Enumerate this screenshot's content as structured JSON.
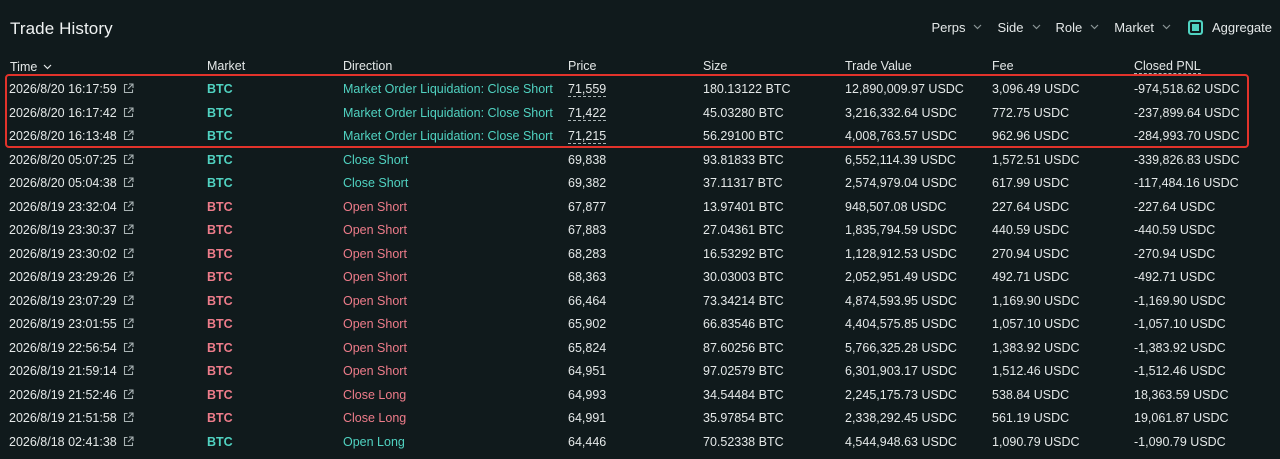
{
  "header": {
    "title": "Trade History",
    "filters": [
      "Perps",
      "Side",
      "Role",
      "Market"
    ],
    "aggregate_label": "Aggregate",
    "aggregate_checked": true
  },
  "columns": {
    "time": "Time",
    "market": "Market",
    "direction": "Direction",
    "price": "Price",
    "size": "Size",
    "trade_value": "Trade Value",
    "fee": "Fee",
    "closed_pnl": "Closed PNL"
  },
  "colors": {
    "accent_teal": "#50d2c1",
    "sell_red": "#ee7c8a",
    "highlight_red": "#e2332b",
    "background": "#101a1c"
  },
  "rows": [
    {
      "time": "2026/8/20 16:17:59",
      "market": "BTC",
      "market_side": "buy",
      "direction": "Market Order Liquidation: Close Short",
      "dir_side": "buy",
      "price": "71,559",
      "price_dotted": true,
      "size": "180.13122 BTC",
      "trade_value": "12,890,009.97 USDC",
      "fee": "3,096.49 USDC",
      "closed_pnl": "-974,518.62 USDC"
    },
    {
      "time": "2026/8/20 16:17:42",
      "market": "BTC",
      "market_side": "buy",
      "direction": "Market Order Liquidation: Close Short",
      "dir_side": "buy",
      "price": "71,422",
      "price_dotted": true,
      "size": "45.03280 BTC",
      "trade_value": "3,216,332.64 USDC",
      "fee": "772.75 USDC",
      "closed_pnl": "-237,899.64 USDC"
    },
    {
      "time": "2026/8/20 16:13:48",
      "market": "BTC",
      "market_side": "buy",
      "direction": "Market Order Liquidation: Close Short",
      "dir_side": "buy",
      "price": "71,215",
      "price_dotted": true,
      "size": "56.29100 BTC",
      "trade_value": "4,008,763.57 USDC",
      "fee": "962.96 USDC",
      "closed_pnl": "-284,993.70 USDC"
    },
    {
      "time": "2026/8/20 05:07:25",
      "market": "BTC",
      "market_side": "buy",
      "direction": "Close Short",
      "dir_side": "buy",
      "price": "69,838",
      "price_dotted": false,
      "size": "93.81833 BTC",
      "trade_value": "6,552,114.39 USDC",
      "fee": "1,572.51 USDC",
      "closed_pnl": "-339,826.83 USDC"
    },
    {
      "time": "2026/8/20 05:04:38",
      "market": "BTC",
      "market_side": "buy",
      "direction": "Close Short",
      "dir_side": "buy",
      "price": "69,382",
      "price_dotted": false,
      "size": "37.11317 BTC",
      "trade_value": "2,574,979.04 USDC",
      "fee": "617.99 USDC",
      "closed_pnl": "-117,484.16 USDC"
    },
    {
      "time": "2026/8/19 23:32:04",
      "market": "BTC",
      "market_side": "sell",
      "direction": "Open Short",
      "dir_side": "sell",
      "price": "67,877",
      "price_dotted": false,
      "size": "13.97401 BTC",
      "trade_value": "948,507.08 USDC",
      "fee": "227.64 USDC",
      "closed_pnl": "-227.64 USDC"
    },
    {
      "time": "2026/8/19 23:30:37",
      "market": "BTC",
      "market_side": "sell",
      "direction": "Open Short",
      "dir_side": "sell",
      "price": "67,883",
      "price_dotted": false,
      "size": "27.04361 BTC",
      "trade_value": "1,835,794.59 USDC",
      "fee": "440.59 USDC",
      "closed_pnl": "-440.59 USDC"
    },
    {
      "time": "2026/8/19 23:30:02",
      "market": "BTC",
      "market_side": "sell",
      "direction": "Open Short",
      "dir_side": "sell",
      "price": "68,283",
      "price_dotted": false,
      "size": "16.53292 BTC",
      "trade_value": "1,128,912.53 USDC",
      "fee": "270.94 USDC",
      "closed_pnl": "-270.94 USDC"
    },
    {
      "time": "2026/8/19 23:29:26",
      "market": "BTC",
      "market_side": "sell",
      "direction": "Open Short",
      "dir_side": "sell",
      "price": "68,363",
      "price_dotted": false,
      "size": "30.03003 BTC",
      "trade_value": "2,052,951.49 USDC",
      "fee": "492.71 USDC",
      "closed_pnl": "-492.71 USDC"
    },
    {
      "time": "2026/8/19 23:07:29",
      "market": "BTC",
      "market_side": "sell",
      "direction": "Open Short",
      "dir_side": "sell",
      "price": "66,464",
      "price_dotted": false,
      "size": "73.34214 BTC",
      "trade_value": "4,874,593.95 USDC",
      "fee": "1,169.90 USDC",
      "closed_pnl": "-1,169.90 USDC"
    },
    {
      "time": "2026/8/19 23:01:55",
      "market": "BTC",
      "market_side": "sell",
      "direction": "Open Short",
      "dir_side": "sell",
      "price": "65,902",
      "price_dotted": false,
      "size": "66.83546 BTC",
      "trade_value": "4,404,575.85 USDC",
      "fee": "1,057.10 USDC",
      "closed_pnl": "-1,057.10 USDC"
    },
    {
      "time": "2026/8/19 22:56:54",
      "market": "BTC",
      "market_side": "sell",
      "direction": "Open Short",
      "dir_side": "sell",
      "price": "65,824",
      "price_dotted": false,
      "size": "87.60256 BTC",
      "trade_value": "5,766,325.28 USDC",
      "fee": "1,383.92 USDC",
      "closed_pnl": "-1,383.92 USDC"
    },
    {
      "time": "2026/8/19 21:59:14",
      "market": "BTC",
      "market_side": "sell",
      "direction": "Open Short",
      "dir_side": "sell",
      "price": "64,951",
      "price_dotted": false,
      "size": "97.02579 BTC",
      "trade_value": "6,301,903.17 USDC",
      "fee": "1,512.46 USDC",
      "closed_pnl": "-1,512.46 USDC"
    },
    {
      "time": "2026/8/19 21:52:46",
      "market": "BTC",
      "market_side": "sell",
      "direction": "Close Long",
      "dir_side": "sell",
      "price": "64,993",
      "price_dotted": false,
      "size": "34.54484 BTC",
      "trade_value": "2,245,175.73 USDC",
      "fee": "538.84 USDC",
      "closed_pnl": "18,363.59 USDC"
    },
    {
      "time": "2026/8/19 21:51:58",
      "market": "BTC",
      "market_side": "sell",
      "direction": "Close Long",
      "dir_side": "sell",
      "price": "64,991",
      "price_dotted": false,
      "size": "35.97854 BTC",
      "trade_value": "2,338,292.45 USDC",
      "fee": "561.19 USDC",
      "closed_pnl": "19,061.87 USDC"
    },
    {
      "time": "2026/8/18 02:41:38",
      "market": "BTC",
      "market_side": "buy",
      "direction": "Open Long",
      "dir_side": "buy",
      "price": "64,446",
      "price_dotted": false,
      "size": "70.52338 BTC",
      "trade_value": "4,544,948.63 USDC",
      "fee": "1,090.79 USDC",
      "closed_pnl": "-1,090.79 USDC"
    }
  ]
}
